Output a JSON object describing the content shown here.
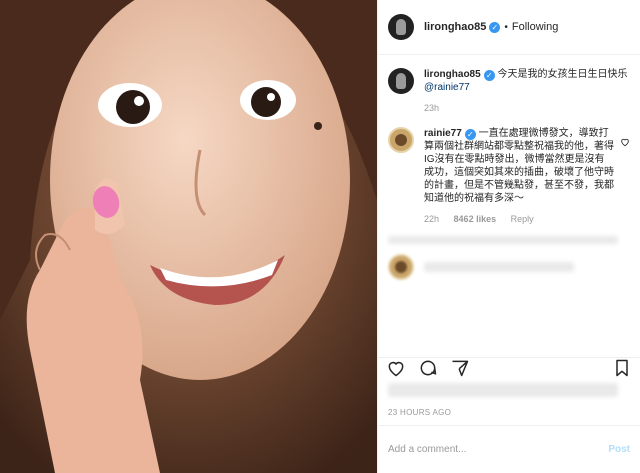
{
  "header": {
    "username": "lironghao85",
    "dot": "•",
    "follow_label": "Following"
  },
  "caption": {
    "username": "lironghao85",
    "text": "今天是我的女孩生日生日快乐",
    "mention": "@rainie77"
  },
  "caption_time": "23h",
  "comment": {
    "username": "rainie77",
    "text": "一直在處理微博發文，導致打算兩個社群網站都零點整祝福我的他，著得IG沒有在零點時發出，微博當然更是沒有成功，這個突如其來的插曲，破壞了他守時的計畫，但是不管幾點發，甚至不發，我都知道他的祝福有多深～",
    "time": "22h",
    "likes": "8462 likes",
    "reply": "Reply"
  },
  "post_time": "23 HOURS AGO",
  "add_comment": {
    "placeholder": "Add a comment...",
    "post_label": "Post"
  },
  "colors": {
    "verified": "#3897f0",
    "link": "#003569",
    "muted": "#999999"
  }
}
